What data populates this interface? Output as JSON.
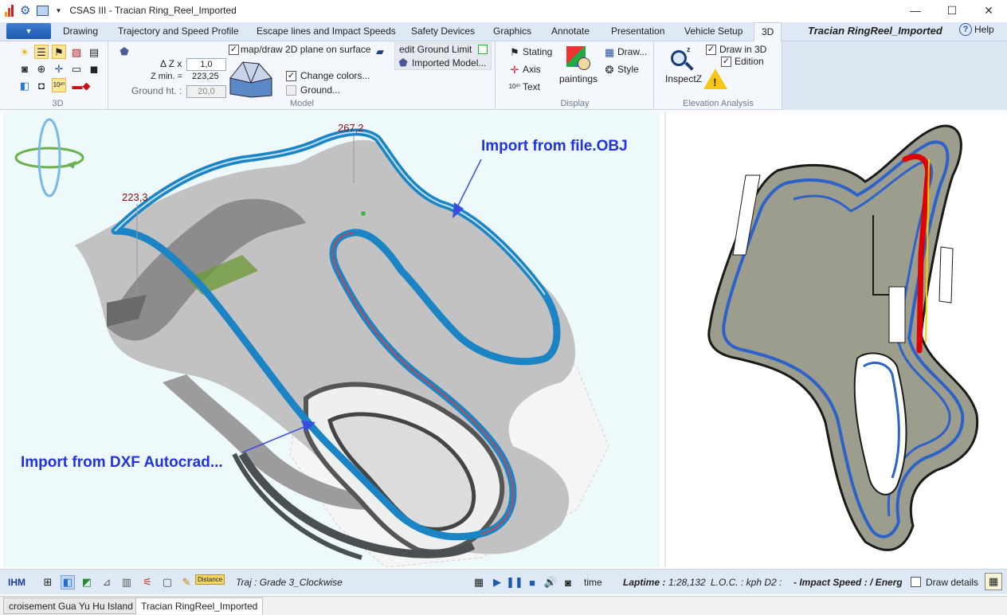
{
  "window": {
    "title": "CSAS III - Tracian Ring_Reel_Imported",
    "minimize": "—",
    "maximize": "☐",
    "close": "✕"
  },
  "menu": {
    "tabs": [
      "Drawing",
      "Trajectory and Speed Profile",
      "Escape lines and Impact Speeds",
      "Safety Devices",
      "Graphics",
      "Annotate",
      "Presentation",
      "Vehicle Setup",
      "3D"
    ],
    "active_tab": "3D",
    "document_title": "Tracian RingReel_Imported",
    "help": "Help"
  },
  "ribbon": {
    "group_3d": {
      "label": "3D"
    },
    "group_model": {
      "label": "Model",
      "dz_label": "Δ Z x",
      "dz_value": "1,0",
      "zmin_label": "Z min. =",
      "zmin_value": "223,25",
      "ground_label": "Ground ht. :",
      "ground_value": "20,0",
      "map_draw_checkbox": "map/draw 2D plane on surface",
      "change_colors": "Change colors...",
      "ground": "Ground...",
      "edit_ground_limit": "edit Ground Limit",
      "imported_model": "Imported Model..."
    },
    "group_display": {
      "label": "Display",
      "stating": "Stating",
      "axis": "Axis",
      "text": "Text",
      "paintings": "paintings",
      "draw": "Draw...",
      "style": "Style"
    },
    "group_elevation": {
      "label": "Elevation Analysis",
      "inspectz": "InspectZ",
      "draw_in_3d": "Draw in 3D",
      "edition": "Edition"
    }
  },
  "viewport": {
    "annotation_obj": "Import from file.OBJ",
    "annotation_dxf": "Import from DXF Autocrad...",
    "height_left": "223,3",
    "height_right": "267,2"
  },
  "statusbar": {
    "ihm": "IHM",
    "distance": "Distance",
    "traj": "Traj :  Grade 3_Clockwise",
    "time": "time",
    "laptime_label": "Laptime :",
    "laptime_value": "1:28,132",
    "loc": "L.O.C. : kph  D2 :",
    "impact": "- Impact Speed :  / Energ",
    "draw_details": "Draw details"
  },
  "bottom_tabs": [
    "croisement Gua Yu Hu Island",
    "Tracian RingReel_Imported"
  ],
  "colors": {
    "accent": "#1d59b0",
    "track_blue": "#1b84c4",
    "annotation": "#2233dd",
    "racing_line": "#e00000"
  }
}
